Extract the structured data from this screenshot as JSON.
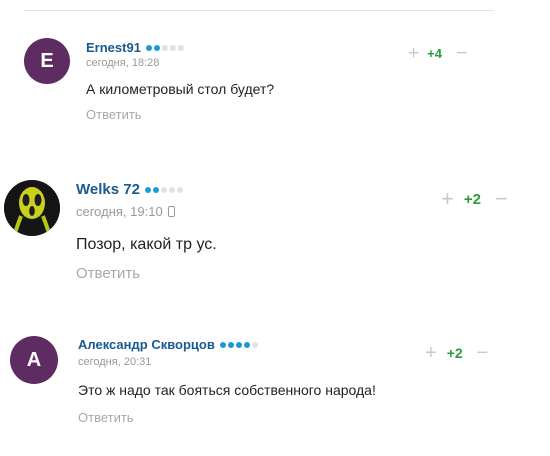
{
  "reply_label": "Ответить",
  "colors": {
    "author": "#1a5a8f",
    "score": "#2a9d3c",
    "avatar_letter_bg": "#5e2c63",
    "rank_dot_on": "#1b9ad6"
  },
  "comments": [
    {
      "avatar_letter": "E",
      "author": "Ernest91",
      "rank_dots": 2,
      "date": "сегодня, 18:28",
      "text": "А километровый стол будет?",
      "score": "+4",
      "device_icon": null
    },
    {
      "avatar_image": "yellow-ghost-mask-avatar",
      "author": "Welks 72",
      "rank_dots": 2,
      "date": "сегодня, 19:10",
      "text": "Позор, какой тр ус.",
      "score": "+2",
      "device_icon": "mobile-phone-icon"
    },
    {
      "avatar_letter": "А",
      "author": "Александр Скворцов",
      "rank_dots": 4,
      "date": "сегодня, 20:31",
      "text": "Это ж надо так бояться собственного народа!",
      "score": "+2",
      "device_icon": null
    }
  ]
}
